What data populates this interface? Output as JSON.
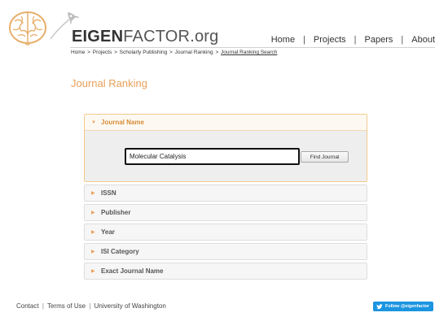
{
  "header": {
    "logo_bold": "EIGEN",
    "logo_light": "FACTOR",
    "logo_suffix": ".org",
    "nav": [
      "Home",
      "Projects",
      "Papers",
      "About"
    ],
    "nav_separator": "|"
  },
  "breadcrumb": {
    "items": [
      "Home",
      "Projects",
      "Scholarly Publishing",
      "Journal Ranking",
      "Journal Ranking Search"
    ],
    "separator": ">"
  },
  "page_title": "Journal Ranking",
  "accordion": {
    "open_section": {
      "label": "Journal Name",
      "input_value": "Molecular Catalysis",
      "button_label": "Find Journal"
    },
    "sections": [
      "ISSN",
      "Publisher",
      "Year",
      "ISI Category",
      "Exact Journal Name"
    ],
    "caret_open": "▼",
    "caret_closed": "▶"
  },
  "footer": {
    "links": [
      "Contact",
      "Terms of Use",
      "University of Washington"
    ],
    "separator": "|",
    "twitter_label": "Follow @eigenfactor"
  },
  "colors": {
    "accent": "#e8a05a",
    "twitter_blue": "#1b95e0"
  }
}
